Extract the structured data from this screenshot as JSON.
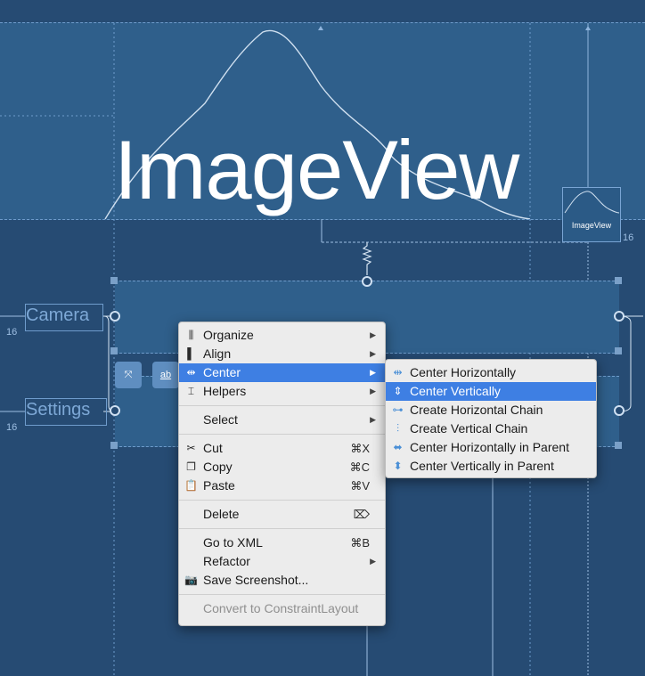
{
  "canvas": {
    "image_view": {
      "label": "ImageView"
    },
    "thumbnail": {
      "label": "ImageView"
    },
    "margin_labels": [
      "16",
      "16",
      "16"
    ],
    "side_labels": {
      "camera": "Camera",
      "settings": "Settings"
    },
    "toolbar": {
      "clear_icon": "clear-constraints-icon",
      "baseline_label": "ab"
    }
  },
  "context_menu": {
    "items": [
      {
        "id": "organize",
        "label": "Organize",
        "icon": "organize-icon",
        "has_submenu": true
      },
      {
        "id": "align",
        "label": "Align",
        "icon": "align-icon",
        "has_submenu": true
      },
      {
        "id": "center",
        "label": "Center",
        "icon": "center-icon",
        "has_submenu": true,
        "highlighted": true
      },
      {
        "id": "helpers",
        "label": "Helpers",
        "icon": "helpers-icon",
        "has_submenu": true
      },
      {
        "id": "select",
        "label": "Select",
        "has_submenu": true
      },
      {
        "id": "cut",
        "label": "Cut",
        "icon": "scissors-icon",
        "shortcut": "⌘X"
      },
      {
        "id": "copy",
        "label": "Copy",
        "icon": "copy-icon",
        "shortcut": "⌘C"
      },
      {
        "id": "paste",
        "label": "Paste",
        "icon": "paste-icon",
        "shortcut": "⌘V"
      },
      {
        "id": "delete",
        "label": "Delete",
        "shortcut": "⌦"
      },
      {
        "id": "goto_xml",
        "label": "Go to XML",
        "shortcut": "⌘B"
      },
      {
        "id": "refactor",
        "label": "Refactor",
        "has_submenu": true
      },
      {
        "id": "screenshot",
        "label": "Save Screenshot...",
        "icon": "camera-icon"
      },
      {
        "id": "convert",
        "label": "Convert to ConstraintLayout",
        "disabled": true
      }
    ]
  },
  "center_submenu": {
    "items": [
      {
        "label": "Center Horizontally",
        "icon": "center-horizontally-icon"
      },
      {
        "label": "Center Vertically",
        "icon": "center-vertically-icon",
        "highlighted": true
      },
      {
        "label": "Create Horizontal Chain",
        "icon": "horizontal-chain-icon"
      },
      {
        "label": "Create Vertical Chain",
        "icon": "vertical-chain-icon"
      },
      {
        "label": "Center Horizontally in Parent",
        "icon": "center-horizontally-parent-icon"
      },
      {
        "label": "Center Vertically in Parent",
        "icon": "center-vertically-parent-icon"
      }
    ]
  },
  "colors": {
    "background": "#264b73",
    "panel": "#2f5f8b",
    "highlight": "#3e7fe3",
    "menu_bg": "#ececec"
  }
}
